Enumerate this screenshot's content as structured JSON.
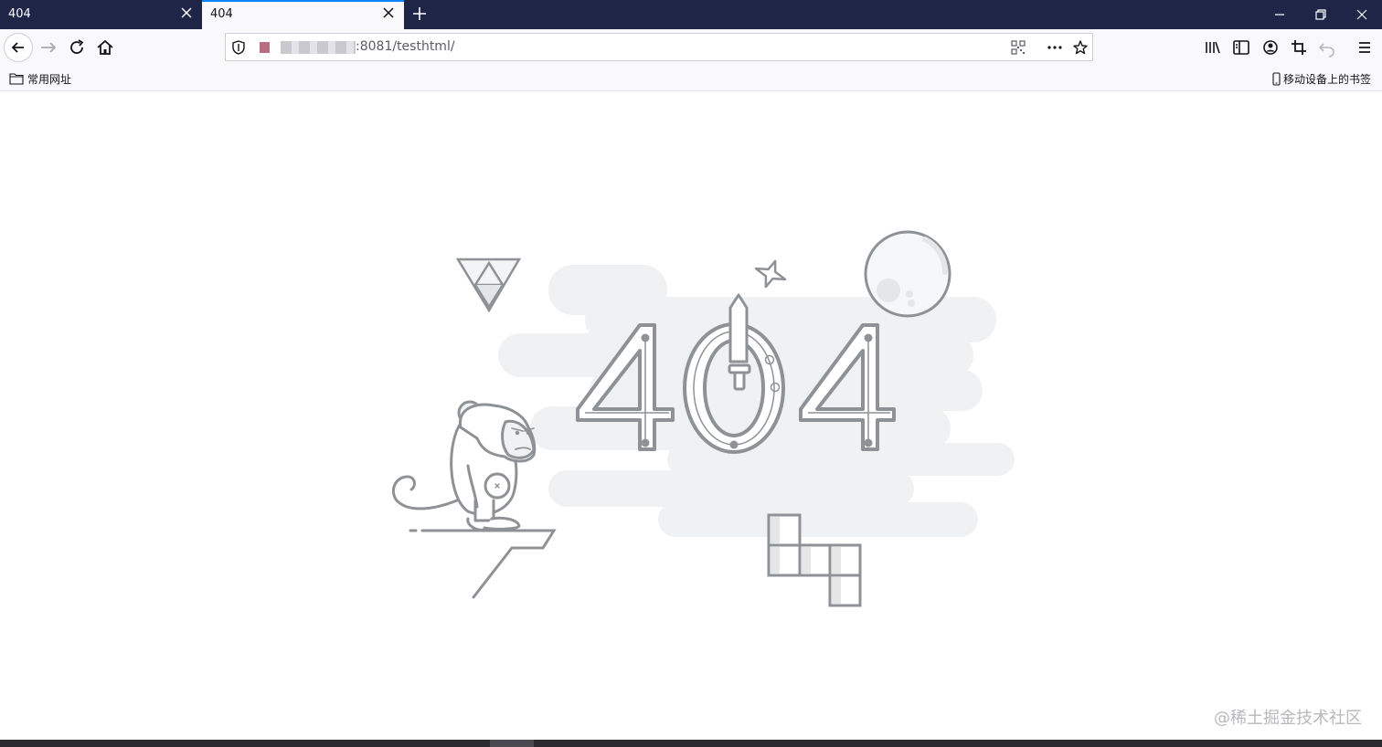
{
  "tabs": [
    {
      "title": "404",
      "active": false
    },
    {
      "title": "404",
      "active": true
    }
  ],
  "address": {
    "url_visible": ":8081/testhtml/"
  },
  "bookmarks": {
    "left_folder": "常用网址",
    "mobile": "移动设备上的书签"
  },
  "page": {
    "big_text": "404"
  },
  "watermark": "@稀土掘金技术社区",
  "colors": {
    "tabstrip": "#1f2547",
    "accent": "#0a84ff",
    "line_gray": "#8e9296",
    "cloud_gray": "#eff1f3"
  }
}
